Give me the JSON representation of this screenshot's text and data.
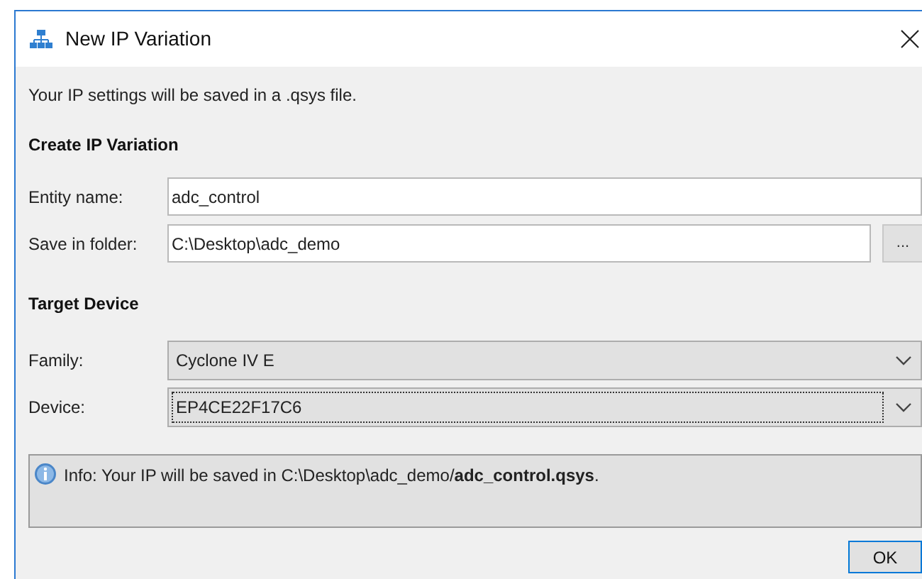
{
  "window": {
    "title": "New IP Variation"
  },
  "intro": "Your IP settings will be saved in a .qsys file.",
  "create_section": {
    "heading": "Create IP Variation",
    "entity_name": {
      "label": "Entity name:",
      "value": "adc_control"
    },
    "save_in_folder": {
      "label": "Save in folder:",
      "value": "C:\\Desktop\\adc_demo",
      "browse_button": "..."
    }
  },
  "target_section": {
    "heading": "Target Device",
    "family": {
      "label": "Family:",
      "value": "Cyclone IV E",
      "focused": false
    },
    "device": {
      "label": "Device:",
      "value": "EP4CE22F17C6",
      "focused": true
    }
  },
  "info": "Info: Your IP will be saved in C:\\Desktop\\adc_demo/**adc_control.qsys**.",
  "buttons": [
    "OK"
  ]
}
